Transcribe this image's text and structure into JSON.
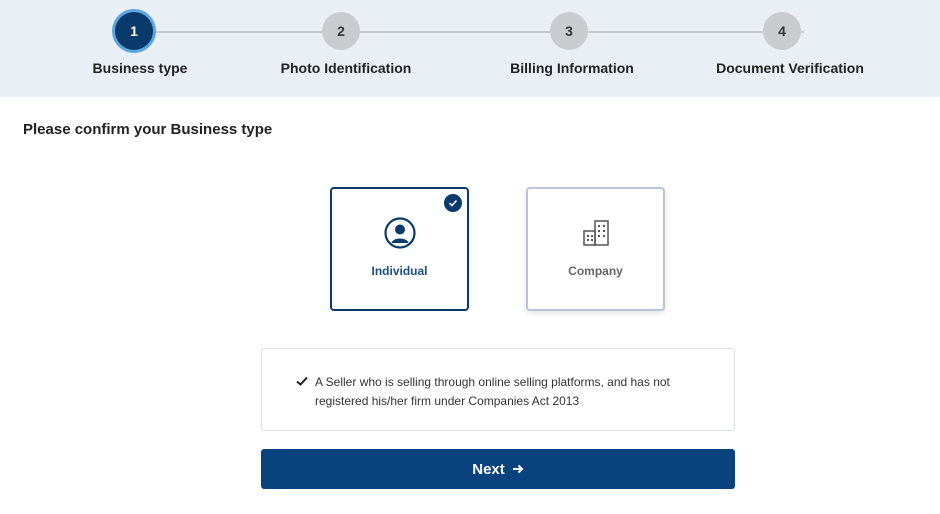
{
  "stepper": {
    "steps": [
      {
        "number": "1",
        "label": "Business type",
        "state": "active"
      },
      {
        "number": "2",
        "label": "Photo Identification",
        "state": "pending"
      },
      {
        "number": "3",
        "label": "Billing Information",
        "state": "pending"
      },
      {
        "number": "4",
        "label": "Document Verification",
        "state": "pending"
      }
    ]
  },
  "page": {
    "heading": "Please confirm your Business type"
  },
  "options": {
    "individual": {
      "label": "Individual",
      "selected": true,
      "icon": "user-circle-icon"
    },
    "company": {
      "label": "Company",
      "selected": false,
      "icon": "building-icon"
    }
  },
  "info": {
    "line1": "A Seller who is selling through online selling platforms, and has not",
    "line2": "registered his/her firm under Companies Act 2013"
  },
  "actions": {
    "next_label": "Next"
  },
  "colors": {
    "primary": "#0a3a6b",
    "active_ring": "#5aa7e0",
    "stepper_bg": "#eaeef5"
  }
}
